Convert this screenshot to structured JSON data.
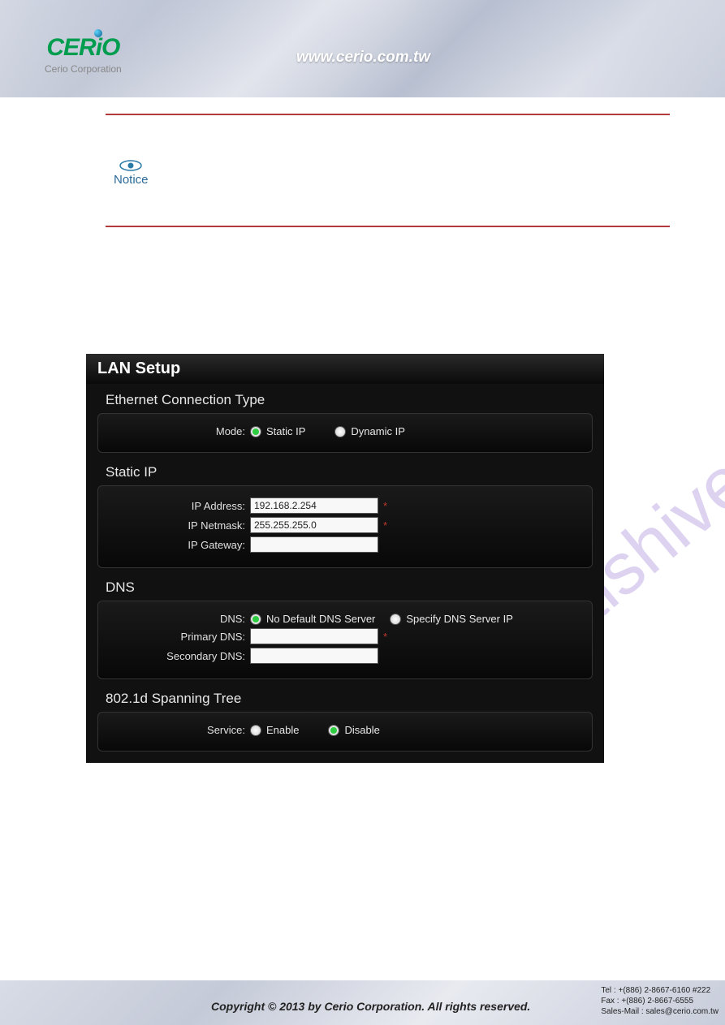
{
  "header": {
    "logo_main": "CERiO",
    "logo_sub": "Cerio Corporation",
    "url": "www.cerio.com.tw"
  },
  "notice": {
    "label": "Notice"
  },
  "watermark": "manualshive.com",
  "panel": {
    "title": "LAN Setup",
    "ethernet": {
      "legend": "Ethernet Connection Type",
      "mode_label": "Mode:",
      "opt_static": "Static IP",
      "opt_dynamic": "Dynamic IP",
      "selected": "static"
    },
    "static_ip": {
      "legend": "Static IP",
      "ip_address_label": "IP Address:",
      "ip_address": "192.168.2.254",
      "ip_netmask_label": "IP Netmask:",
      "ip_netmask": "255.255.255.0",
      "ip_gateway_label": "IP Gateway:",
      "ip_gateway": ""
    },
    "dns": {
      "legend": "DNS",
      "dns_label": "DNS:",
      "opt_no_default": "No Default DNS Server",
      "opt_specify": "Specify DNS Server IP",
      "selected": "no_default",
      "primary_label": "Primary DNS:",
      "primary": "",
      "secondary_label": "Secondary DNS:",
      "secondary": ""
    },
    "spanning": {
      "legend": "802.1d Spanning Tree",
      "service_label": "Service:",
      "opt_enable": "Enable",
      "opt_disable": "Disable",
      "selected": "disable"
    },
    "required_marker": "*"
  },
  "footer": {
    "copyright": "Copyright © 2013 by Cerio Corporation. All rights reserved.",
    "tel": "Tel : +(886) 2-8667-6160 #222",
    "fax": "Fax : +(886) 2-8667-6555",
    "mail": "Sales-Mail : sales@cerio.com.tw"
  }
}
